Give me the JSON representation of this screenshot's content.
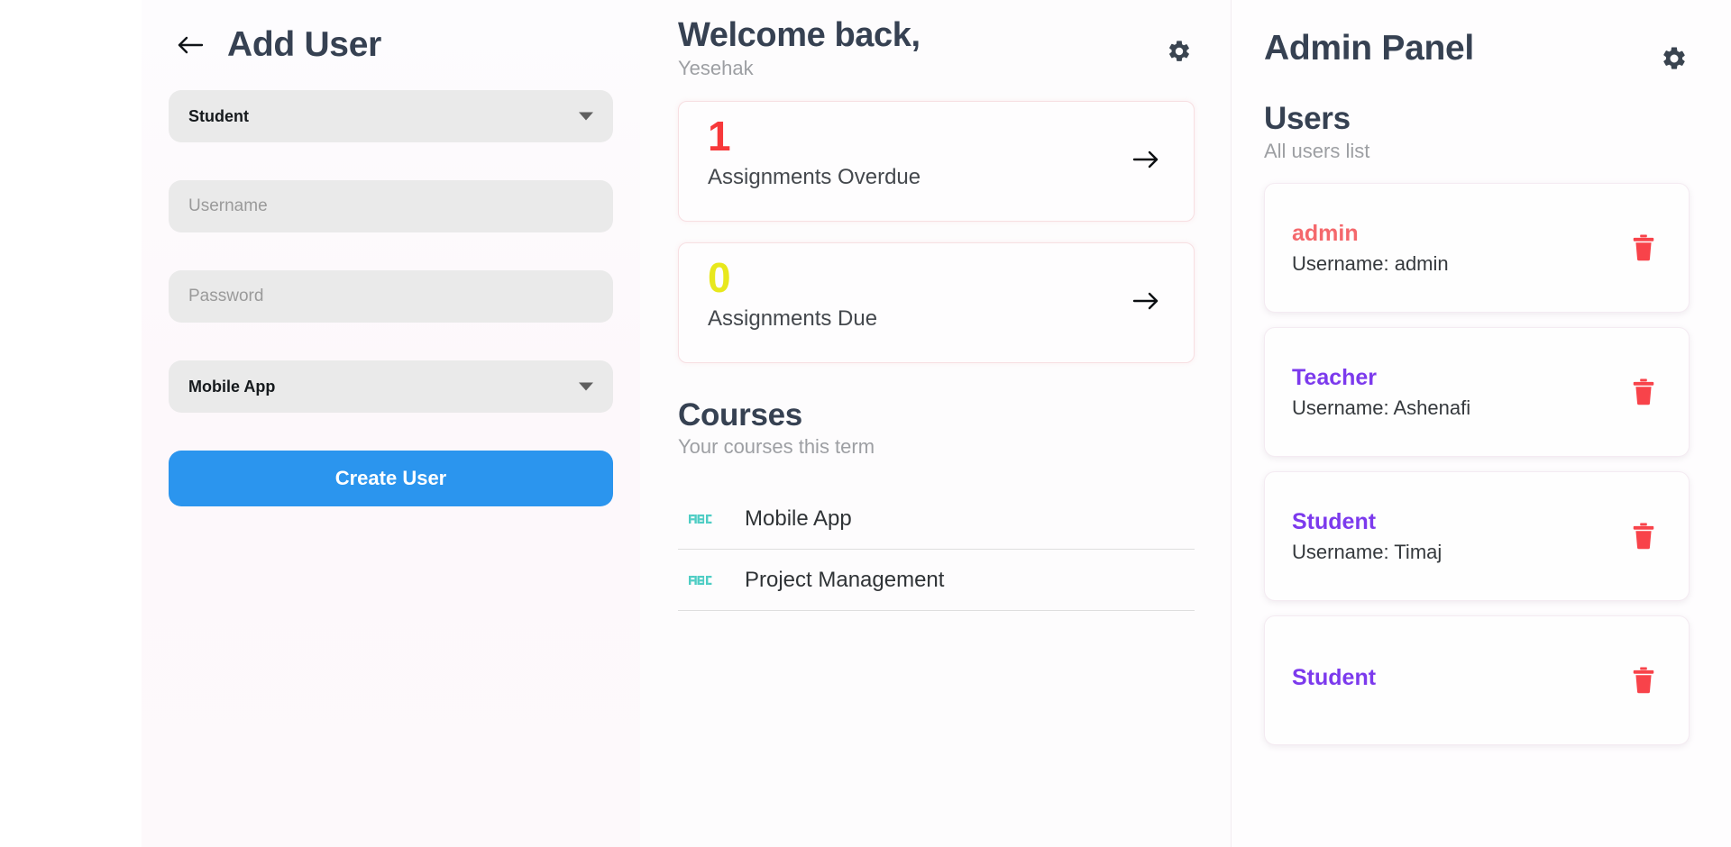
{
  "add_user": {
    "title": "Add User",
    "back_icon": "arrow-left-icon",
    "role_select": {
      "value": "Student",
      "caret_icon": "chevron-down-icon"
    },
    "username_field": {
      "value": "",
      "placeholder": "Username"
    },
    "password_field": {
      "value": "",
      "placeholder": "Password"
    },
    "course_select": {
      "value": "Mobile App",
      "caret_icon": "chevron-down-icon"
    },
    "create_button": "Create User",
    "button_color": "#2b95ee"
  },
  "dashboard": {
    "welcome_title": "Welcome back,",
    "welcome_name": "Yesehak",
    "settings_icon": "gear-icon",
    "stats": [
      {
        "number": "1",
        "label": "Assignments Overdue",
        "number_color": "#f7383a",
        "arrow_icon": "arrow-right-icon"
      },
      {
        "number": "0",
        "label": "Assignments Due",
        "number_color": "#e8e81c",
        "arrow_icon": "arrow-right-icon"
      }
    ],
    "courses": {
      "title": "Courses",
      "subtitle": "Your courses this term",
      "items": [
        {
          "name": "Mobile App",
          "icon": "abc-icon",
          "icon_color": "#4ecdc4"
        },
        {
          "name": "Project Management",
          "icon": "abc-icon",
          "icon_color": "#4ecdc4"
        }
      ]
    }
  },
  "admin": {
    "title": "Admin Panel",
    "settings_icon": "gear-icon",
    "users_title": "Users",
    "users_subtitle": "All users list",
    "delete_icon": "trash-icon",
    "delete_icon_color": "#f8434a",
    "users": [
      {
        "role": "admin",
        "role_color": "#f4686c",
        "username": "Username: admin"
      },
      {
        "role": "Teacher",
        "role_color": "#7c3aed",
        "username": "Username: Ashenafi"
      },
      {
        "role": "Student",
        "role_color": "#7c3aed",
        "username": "Username: Timaj"
      },
      {
        "role": "Student",
        "role_color": "#7c3aed",
        "username": ""
      }
    ]
  }
}
